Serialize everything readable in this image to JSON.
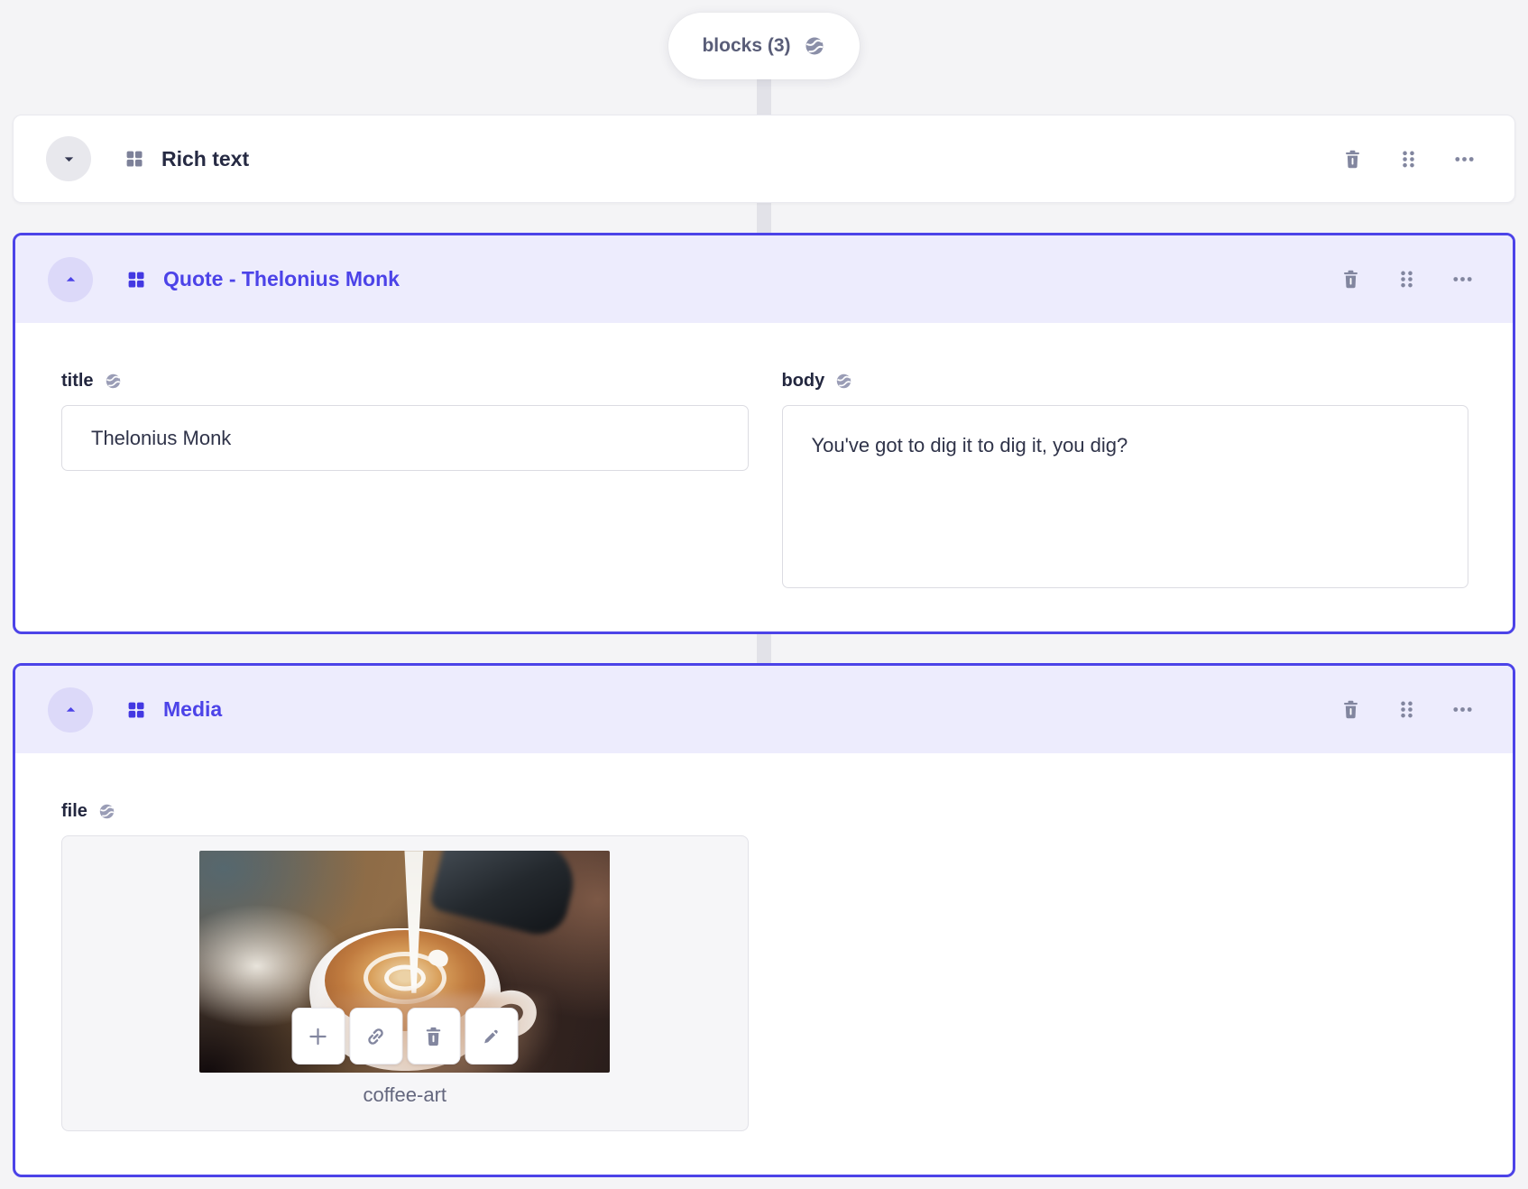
{
  "array_field": {
    "pill_label": "blocks (3)",
    "name": "blocks",
    "count": 3
  },
  "blocks": [
    {
      "title": "Rich text",
      "collapsed": true
    },
    {
      "title": "Quote - Thelonius Monk",
      "collapsed": false,
      "selected": true,
      "fields": [
        {
          "label": "title",
          "value": "Thelonius Monk",
          "localized": true
        },
        {
          "label": "body",
          "value": "You've got to dig it to dig it, you dig?",
          "localized": true
        }
      ]
    },
    {
      "title": "Media",
      "collapsed": false,
      "selected": true,
      "fields": [
        {
          "label": "file",
          "asset_name": "coffee-art",
          "localized": true
        }
      ]
    }
  ],
  "icons": {
    "pill": "globe-icon",
    "collapsed_toggle": "chevron-down-icon",
    "expanded_toggle": "chevron-up-icon",
    "block_type": "blocks-grid-icon",
    "header_actions": [
      "trash-icon",
      "drag-handle-icon",
      "ellipsis-menu-icon"
    ],
    "field_label": "globe-icon",
    "media_actions": [
      "plus-icon",
      "link-icon",
      "trash-icon",
      "pencil-icon"
    ]
  },
  "colors": {
    "page_bg": "#f4f4f6",
    "accent": "#4c43e8",
    "accent_header_bg": "#edecfd",
    "accent_toggle_bg": "#dcd9f9",
    "icon_gray": "#82869f",
    "connector": "#e2e2e8",
    "label_text": "#23273f",
    "title_text": "#262a43",
    "input_text": "#2f3349",
    "muted_text": "#64677e",
    "border": "#dcdce2"
  }
}
